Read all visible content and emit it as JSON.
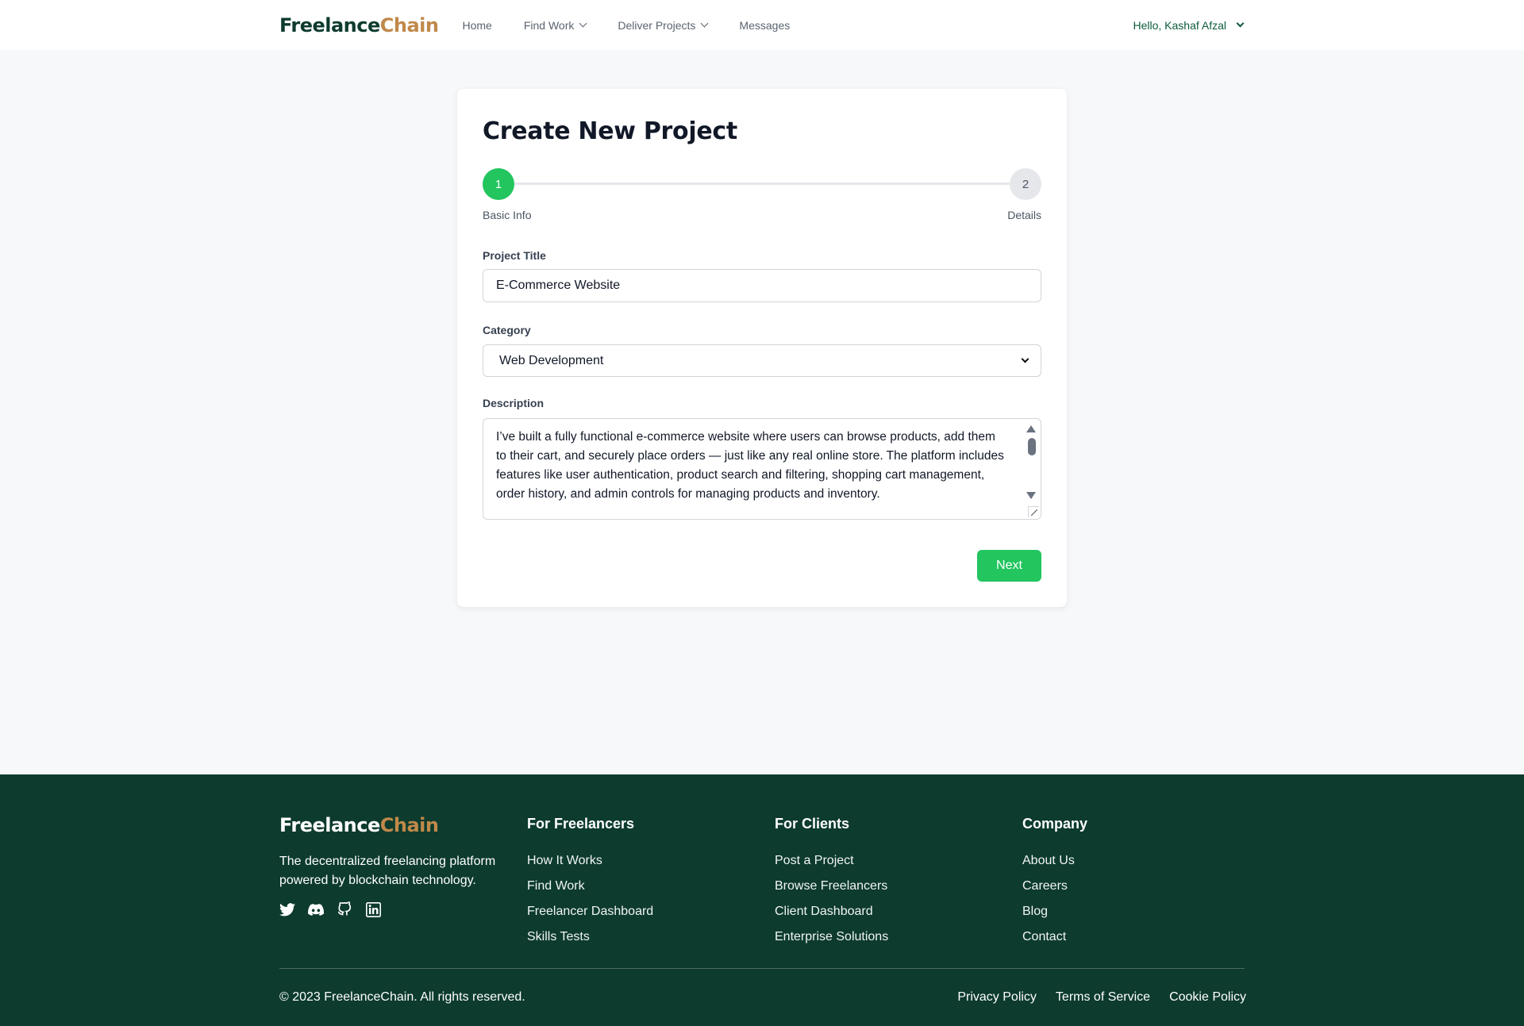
{
  "header": {
    "logo_part1": "Freelance",
    "logo_part2": "Chain",
    "nav": {
      "home": "Home",
      "find_work": "Find Work",
      "deliver_projects": "Deliver Projects",
      "messages": "Messages"
    },
    "user_greeting": "Hello, Kashaf Afzal"
  },
  "form": {
    "title": "Create New Project",
    "steps": [
      {
        "number": "1",
        "label": "Basic Info",
        "active": true
      },
      {
        "number": "2",
        "label": "Details",
        "active": false
      }
    ],
    "project_title_label": "Project Title",
    "project_title_value": "E-Commerce Website",
    "category_label": "Category",
    "category_value": "Web Development",
    "description_label": "Description",
    "description_value": "I’ve built a fully functional e-commerce website where users can browse products, add them to their cart, and securely place orders — just like any real online store. The platform includes features like user authentication, product search and filtering, shopping cart management, order history, and admin controls for managing products and inventory.",
    "next_label": "Next",
    "accent_color": "#22c55e"
  },
  "footer": {
    "logo_part1": "Freelance",
    "logo_part2": "Chain",
    "tagline": "The decentralized freelancing platform powered by blockchain technology.",
    "socials": [
      "twitter-icon",
      "discord-icon",
      "github-icon",
      "linkedin-icon"
    ],
    "columns": [
      {
        "heading": "For Freelancers",
        "links": [
          "How It Works",
          "Find Work",
          "Freelancer Dashboard",
          "Skills Tests"
        ]
      },
      {
        "heading": "For Clients",
        "links": [
          "Post a Project",
          "Browse Freelancers",
          "Client Dashboard",
          "Enterprise Solutions"
        ]
      },
      {
        "heading": "Company",
        "links": [
          "About Us",
          "Careers",
          "Blog",
          "Contact"
        ]
      }
    ],
    "copyright": "© 2023 FreelanceChain. All rights reserved.",
    "legal": [
      "Privacy Policy",
      "Terms of Service",
      "Cookie Policy"
    ],
    "background_color": "#0d3b2e"
  }
}
